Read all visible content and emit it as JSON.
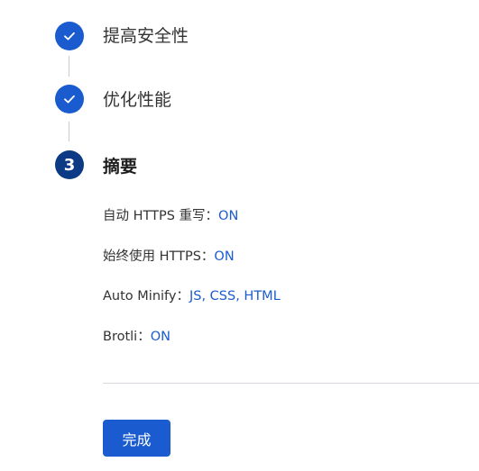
{
  "steps": [
    {
      "title": "提高安全性",
      "state": "done"
    },
    {
      "title": "优化性能",
      "state": "done"
    },
    {
      "title": "摘要",
      "state": "current",
      "number": "3"
    }
  ],
  "summary": [
    {
      "label": "自动 HTTPS 重写：",
      "value": "ON"
    },
    {
      "label": "始终使用 HTTPS：",
      "value": "ON"
    },
    {
      "label": "Auto Minify：",
      "value": "JS, CSS, HTML"
    },
    {
      "label": "Brotli：",
      "value": "ON"
    }
  ],
  "finish_label": "完成",
  "colors": {
    "accent": "#1a5ccf",
    "current_step": "#0c3a84"
  }
}
